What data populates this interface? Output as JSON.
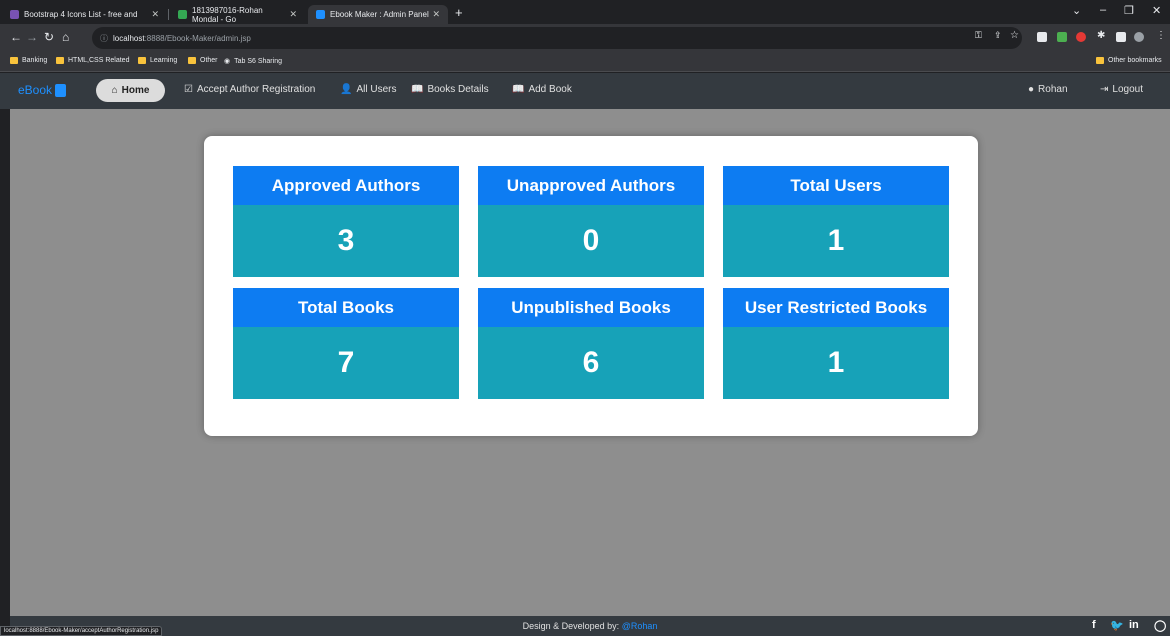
{
  "browser": {
    "tabs": [
      {
        "title": "Bootstrap 4 Icons List - free and",
        "active": false
      },
      {
        "title": "1813987016-Rohan Mondal - Go",
        "active": false
      },
      {
        "title": "Ebook Maker : Admin Panel",
        "active": true
      }
    ],
    "url_host": "localhost",
    "url_rest": ":8888/Ebook-Maker/admin.jsp",
    "bookmarks": [
      "Banking",
      "HTML,CSS Related",
      "Learning",
      "Other",
      "Tab S6 Sharing"
    ],
    "other_bookmarks": "Other bookmarks",
    "status_url": "localhost:8888/Ebook-Maker/acceptAuthorRegistration.jsp"
  },
  "nav": {
    "brand": "eBook",
    "home": "Home",
    "accept": "Accept Author Registration",
    "users": "All Users",
    "books": "Books Details",
    "add": "Add Book",
    "user": "Rohan",
    "logout": "Logout"
  },
  "stats": [
    {
      "label": "Approved Authors",
      "value": "3"
    },
    {
      "label": "Unapproved Authors",
      "value": "0"
    },
    {
      "label": "Total Users",
      "value": "1"
    },
    {
      "label": "Total Books",
      "value": "7"
    },
    {
      "label": "Unpublished Books",
      "value": "6"
    },
    {
      "label": "User Restricted Books",
      "value": "1"
    }
  ],
  "footer": {
    "text": "Design & Developed by:",
    "author": "@Rohan"
  },
  "colors": {
    "card_head": "#0d7cf2",
    "card_body": "#17a2b8",
    "navbar": "#343a40",
    "brand": "#1e90ff"
  }
}
